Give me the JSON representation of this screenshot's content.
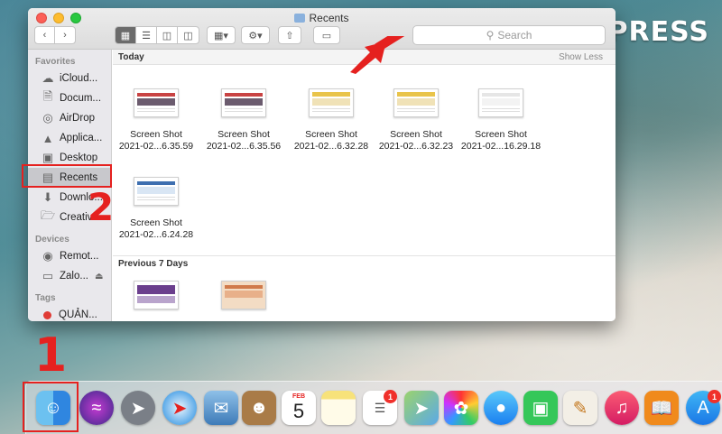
{
  "watermark": {
    "text": "EXPRESS",
    "mark": "35"
  },
  "window": {
    "title": "Recents",
    "search_placeholder": "Search"
  },
  "sidebar": {
    "favorites_heading": "Favorites",
    "favorites": [
      {
        "label": "iCloud...",
        "icon": "cloud-icon"
      },
      {
        "label": "Docum...",
        "icon": "document-icon"
      },
      {
        "label": "AirDrop",
        "icon": "airdrop-icon"
      },
      {
        "label": "Applica...",
        "icon": "applications-icon"
      },
      {
        "label": "Desktop",
        "icon": "desktop-icon"
      },
      {
        "label": "Recents",
        "icon": "recents-icon"
      },
      {
        "label": "Downlo...",
        "icon": "download-icon"
      },
      {
        "label": "Creativ...",
        "icon": "folder-icon"
      }
    ],
    "devices_heading": "Devices",
    "devices": [
      {
        "label": "Remot...",
        "icon": "disc-icon"
      },
      {
        "label": "Zalo...",
        "icon": "disk-icon"
      }
    ],
    "tags_heading": "Tags",
    "tags": [
      {
        "label": "QUẢN...",
        "color": "#e03b35"
      }
    ]
  },
  "content": {
    "today_heading": "Today",
    "show_less": "Show Less",
    "today_files": [
      {
        "line1": "Screen Shot",
        "line2": "2021-02...6.35.59"
      },
      {
        "line1": "Screen Shot",
        "line2": "2021-02...6.35.56"
      },
      {
        "line1": "Screen Shot",
        "line2": "2021-02...6.32.28"
      },
      {
        "line1": "Screen Shot",
        "line2": "2021-02...6.32.23"
      },
      {
        "line1": "Screen Shot",
        "line2": "2021-02...16.29.18"
      },
      {
        "line1": "Screen Shot",
        "line2": "2021-02...6.24.28"
      }
    ],
    "previous_heading": "Previous 7 Days"
  },
  "annotations": {
    "step1": "1",
    "step2": "2",
    "color": "#e5211f"
  },
  "dock": {
    "calendar_month": "FEB",
    "calendar_day": "5",
    "reminders_badge": "1",
    "appstore_badge": "1"
  }
}
